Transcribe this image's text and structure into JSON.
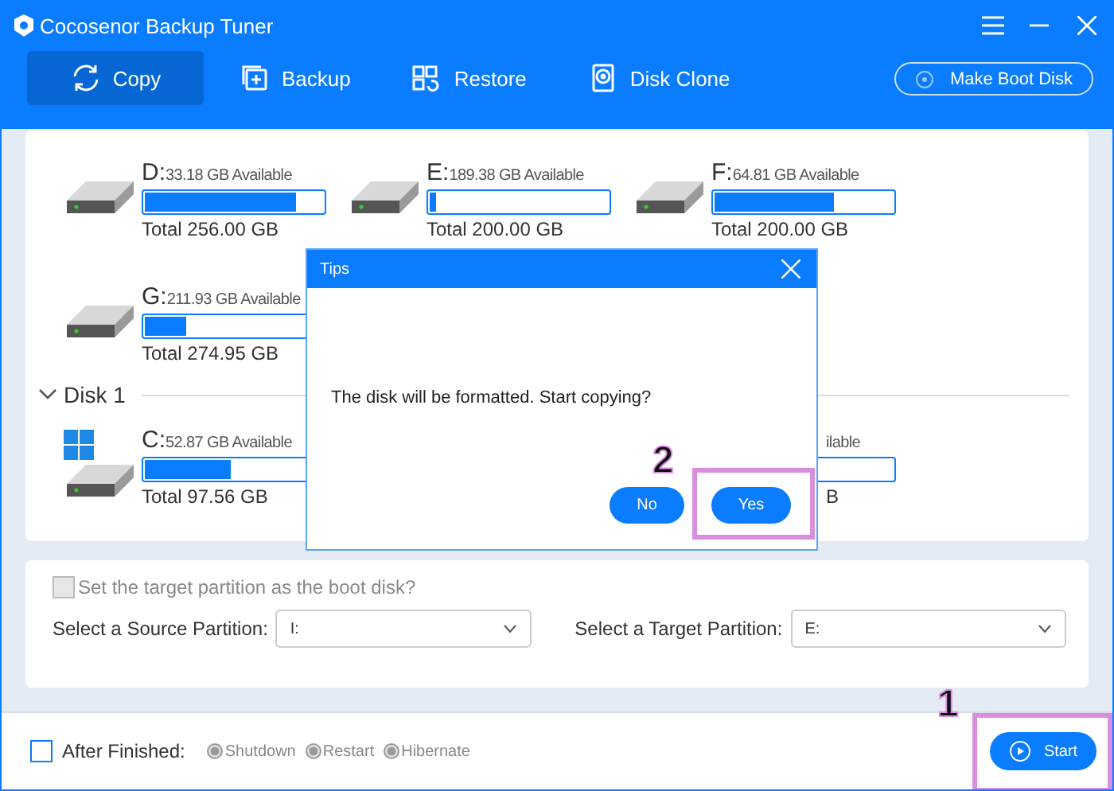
{
  "window": {
    "title": "Cocosenor Backup Tuner"
  },
  "tabs": [
    {
      "label": "Copy",
      "selected": true
    },
    {
      "label": "Backup",
      "selected": false
    },
    {
      "label": "Restore",
      "selected": false
    },
    {
      "label": "Disk Clone",
      "selected": false
    }
  ],
  "boot_button": "Make Boot Disk",
  "drives": [
    {
      "kind": "full",
      "letter": "D:",
      "available": "33.18 GB Available",
      "level": 0.85,
      "total": "Total 256.00 GB"
    },
    {
      "kind": "full",
      "letter": "E:",
      "available": "189.38 GB Available",
      "level": 0.04,
      "total": "Total 200.00 GB"
    },
    {
      "kind": "full",
      "letter": "F:",
      "available": "64.81 GB Available",
      "level": 0.67,
      "total": "Total 200.00 GB"
    },
    {
      "kind": "full",
      "letter": "G:",
      "available": "211.93 GB Available",
      "level": 0.23,
      "total": "Total 274.95 GB"
    }
  ],
  "disk_group": {
    "label": "Disk 1",
    "expanded": true,
    "drives": [
      {
        "kind": "system",
        "letter": "C:",
        "available": "52.87 GB Available",
        "level": 0.48,
        "total": "Total 97.56 GB"
      },
      {
        "kind": "partial",
        "available": "ilable",
        "total": "B"
      }
    ]
  },
  "options": {
    "boot_checkbox": {
      "label": "Set the target partition as the boot disk?",
      "checked": false,
      "disabled": true
    },
    "source": {
      "label": "Select a Source Partition:",
      "value": "I:"
    },
    "target": {
      "label": "Select a Target Partition:",
      "value": "E:"
    }
  },
  "footer": {
    "after_finished": {
      "label": "After Finished:",
      "checked": false
    },
    "radios": [
      {
        "label": "Shutdown",
        "disabled": true
      },
      {
        "label": "Restart",
        "disabled": true
      },
      {
        "label": "Hibernate",
        "disabled": true
      }
    ],
    "start": "Start"
  },
  "dialog": {
    "title": "Tips",
    "message": "The disk will be formatted. Start copying?",
    "buttons": [
      "No",
      "Yes"
    ]
  },
  "callouts": [
    {
      "number": "1"
    },
    {
      "number": "2"
    }
  ]
}
